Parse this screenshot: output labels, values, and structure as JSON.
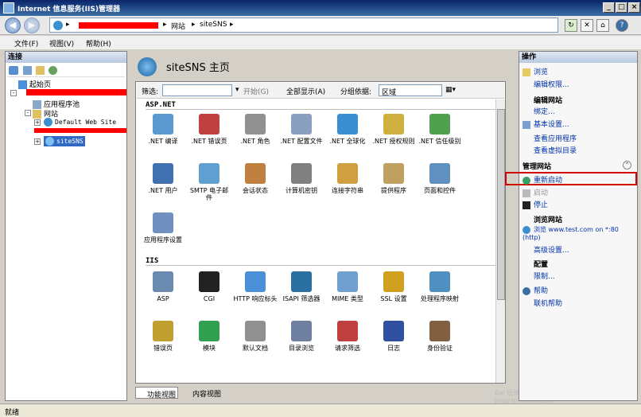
{
  "window": {
    "title": "Internet 信息服务(IIS)管理器"
  },
  "address": {
    "segments": [
      "网站",
      "siteSNS"
    ]
  },
  "menu": [
    "文件(F)",
    "视图(V)",
    "帮助(H)"
  ],
  "connections": {
    "header": "连接",
    "start_page": "起始页",
    "app_pools": "应用程序池",
    "sites": "网站",
    "default_site": "Default Web Site",
    "site_sns": "siteSNS"
  },
  "center": {
    "title": "siteSNS 主页",
    "filter_label": "筛选:",
    "start_btn": "开始(G)",
    "show_all": "全部显示(A)",
    "group_by": "分组依据:",
    "group_value": "区域",
    "aspnet_title": "ASP.NET",
    "iis_title": "IIS",
    "aspnet_features": [
      ".NET 编译",
      ".NET 错误页",
      ".NET 角色",
      ".NET 配置文件",
      ".NET 全球化",
      ".NET 授权规则",
      ".NET 信任级别",
      ".NET 用户",
      "SMTP 电子邮件",
      "会话状态",
      "计算机密钥",
      "连接字符串",
      "提供程序",
      "页面和控件",
      "应用程序设置"
    ],
    "iis_features": [
      "ASP",
      "CGI",
      "HTTP 响应标头",
      "ISAPI 筛选器",
      "MIME 类型",
      "SSL 设置",
      "处理程序映射",
      "错误页",
      "模块",
      "默认文档",
      "目录浏览",
      "请求筛选",
      "日志",
      "身份验证"
    ],
    "view_features": "功能视图",
    "view_content": "内容视图"
  },
  "actions": {
    "header": "操作",
    "browse": "浏览",
    "edit_perms": "编辑权限...",
    "edit_site": "编辑网站",
    "bindings": "绑定...",
    "basic_settings": "基本设置...",
    "view_apps": "查看应用程序",
    "view_vdirs": "查看虚拟目录",
    "manage_site": "管理网站",
    "restart": "重新启动",
    "start": "启动",
    "stop": "停止",
    "browse_site": "浏览网站",
    "browse_link": "浏览 www.test.com on *:80 (http)",
    "advanced": "高级设置...",
    "config": "配置",
    "limits": "限制...",
    "help": "帮助",
    "online_help": "联机帮助"
  },
  "status": {
    "text": "就绪"
  },
  "watermark": "Bai 经验 jingyan.baidu.com",
  "colors": {
    "highlight": "#d00000",
    "link": "#0033aa",
    "selected": "#316ac5"
  }
}
